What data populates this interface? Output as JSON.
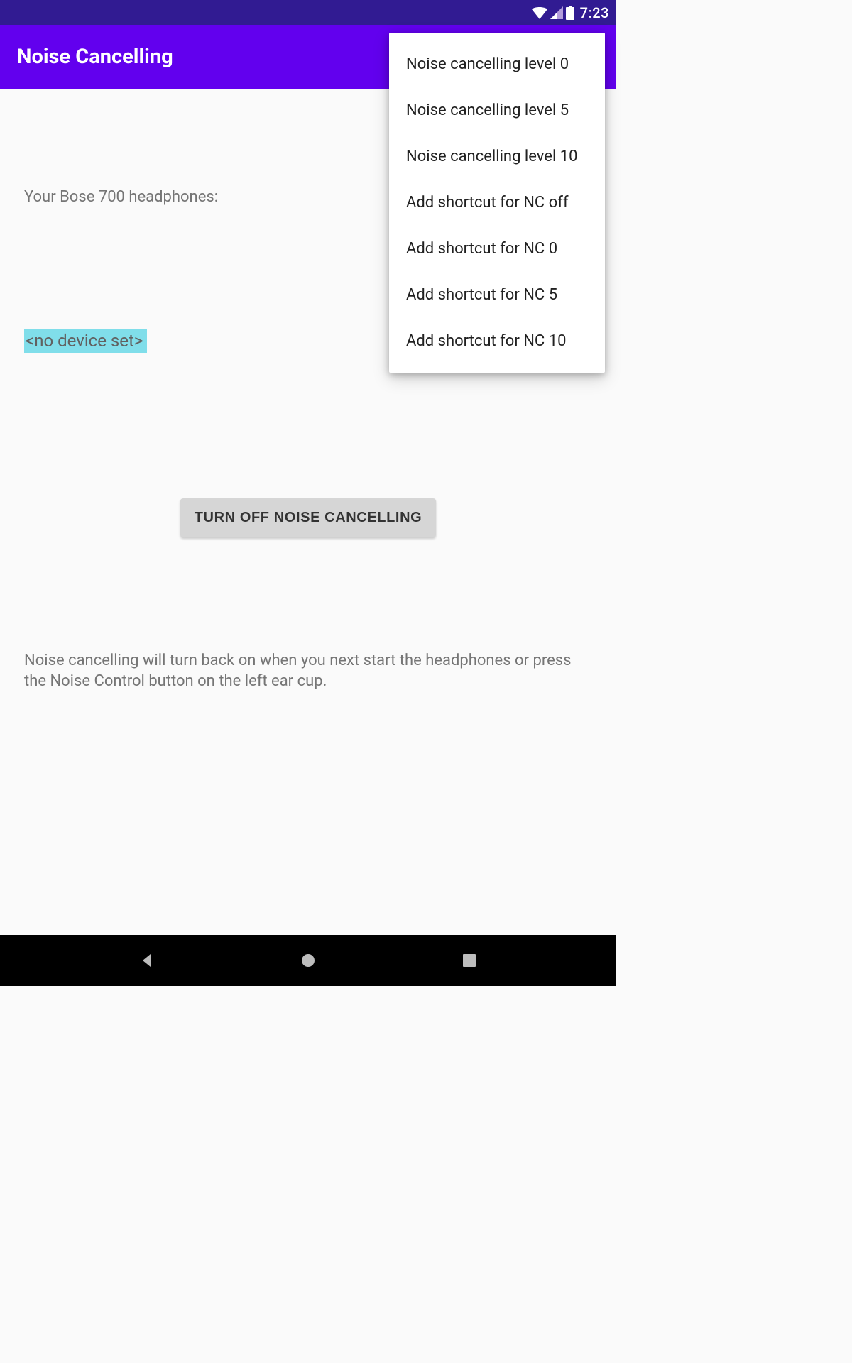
{
  "status_bar": {
    "time": "7:23"
  },
  "app_bar": {
    "title": "Noise Cancelling"
  },
  "content": {
    "headphones_label": "Your Bose 700 headphones:",
    "device_value": "<no device set>",
    "turn_off_button": "TURN OFF NOISE CANCELLING",
    "info_text": "Noise cancelling will turn back on when you next start the headphones or press the Noise Control button on the left ear cup."
  },
  "menu": {
    "items": [
      "Noise cancelling level 0",
      "Noise cancelling level 5",
      "Noise cancelling level 10",
      "Add shortcut for NC off",
      "Add shortcut for NC 0",
      "Add shortcut for NC 5",
      "Add shortcut for NC 10"
    ]
  }
}
